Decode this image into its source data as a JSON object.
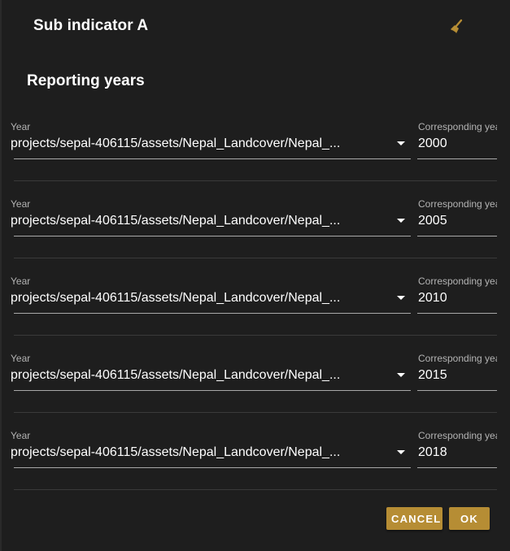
{
  "dialog": {
    "title": "Sub indicator A",
    "section_title": "Reporting years",
    "accent_color": "#b68d34",
    "icons": {
      "clear": "broom-icon",
      "dropdown": "caret-down-icon"
    }
  },
  "rows": [
    {
      "asset_label": "Year",
      "asset_value": "projects/sepal-406115/assets/Nepal_Landcover/Nepal_...",
      "year_label": "Corresponding year",
      "year_value": "2000"
    },
    {
      "asset_label": "Year",
      "asset_value": "projects/sepal-406115/assets/Nepal_Landcover/Nepal_...",
      "year_label": "Corresponding year",
      "year_value": "2005"
    },
    {
      "asset_label": "Year",
      "asset_value": "projects/sepal-406115/assets/Nepal_Landcover/Nepal_...",
      "year_label": "Corresponding year",
      "year_value": "2010"
    },
    {
      "asset_label": "Year",
      "asset_value": "projects/sepal-406115/assets/Nepal_Landcover/Nepal_...",
      "year_label": "Corresponding year",
      "year_value": "2015"
    },
    {
      "asset_label": "Year",
      "asset_value": "projects/sepal-406115/assets/Nepal_Landcover/Nepal_...",
      "year_label": "Corresponding year",
      "year_value": "2018"
    }
  ],
  "actions": {
    "cancel_label": "CANCEL",
    "ok_label": "OK"
  }
}
